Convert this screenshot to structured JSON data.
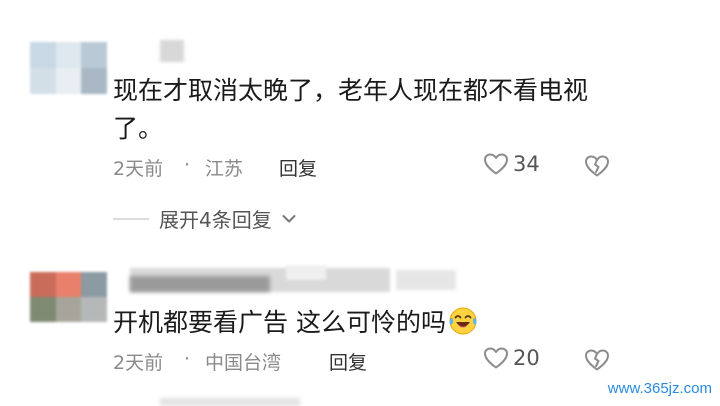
{
  "comments": [
    {
      "avatar_colors": [
        "#c8d8e4",
        "#dfe8ee",
        "#b9c9d6",
        "#d3dfe7",
        "#e8eef2",
        "#a9b8c4"
      ],
      "text_line1": "现在才取消太晚了，老年人现在都不看电视",
      "text_line2": "了。",
      "time": "2天前",
      "separator": "·",
      "location": "江苏",
      "reply_label": "回复",
      "like_count": "34",
      "expand_label": "展开4条回复"
    },
    {
      "avatar_colors": [
        "#c96c5a",
        "#e9806c",
        "#8b9aa3",
        "#7e8a72",
        "#a7a59b",
        "#b5b8b8"
      ],
      "text": "开机都要看广告 这么可怜的吗",
      "time": "2天前",
      "separator": "·",
      "location": "中国台湾",
      "reply_label": "回复",
      "like_count": "20"
    }
  ],
  "icons": {
    "like": "heart-outline-icon",
    "dislike": "broken-heart-icon",
    "expand": "chevron-down-icon",
    "emoji": "laugh-cry-emoji-icon"
  },
  "colors": {
    "meta": "#8a8a8a",
    "watermark": "#2a8be0"
  },
  "watermark": "www.365jz.com"
}
